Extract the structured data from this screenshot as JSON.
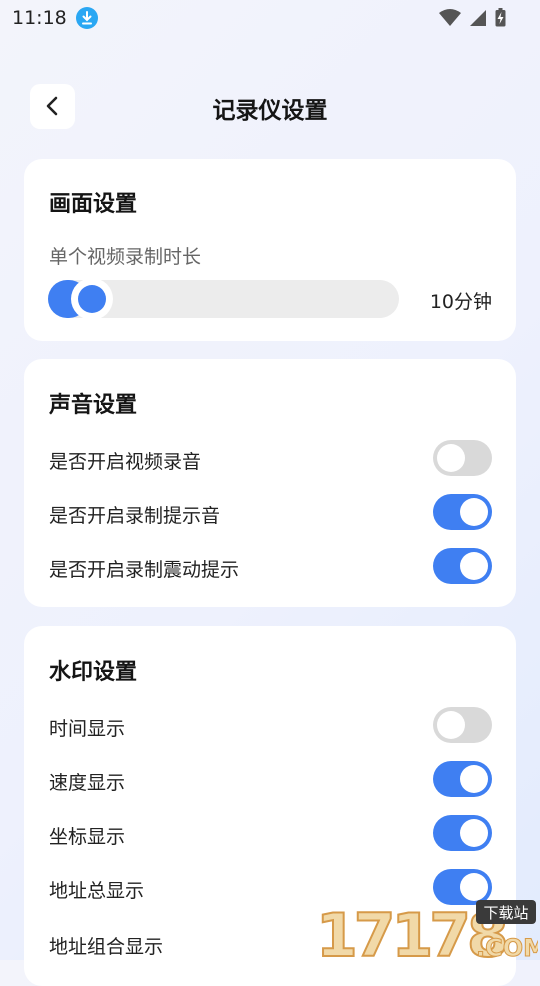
{
  "status_bar": {
    "time": "11:18"
  },
  "header": {
    "title": "记录仪设置"
  },
  "picture_settings": {
    "title": "画面设置",
    "duration_label": "单个视频录制时长",
    "duration_value": "10分钟",
    "slider_level_percent": 0
  },
  "sound_settings": {
    "title": "声音设置",
    "items": [
      {
        "label": "是否开启视频录音",
        "on": false
      },
      {
        "label": "是否开启录制提示音",
        "on": true
      },
      {
        "label": "是否开启录制震动提示",
        "on": true
      }
    ]
  },
  "watermark_settings": {
    "title": "水印设置",
    "items": [
      {
        "label": "时间显示",
        "on": false
      },
      {
        "label": "速度显示",
        "on": true
      },
      {
        "label": "坐标显示",
        "on": true
      },
      {
        "label": "地址总显示",
        "on": true
      },
      {
        "label": "地址组合显示"
      }
    ]
  },
  "site_watermark": {
    "text": "17178",
    "badge": "下载站",
    "suffix": ".COM"
  },
  "colors": {
    "accent": "#3f7ff2",
    "toggle_off": "#d9d9d9",
    "download_badge": "#2aa7f3"
  }
}
